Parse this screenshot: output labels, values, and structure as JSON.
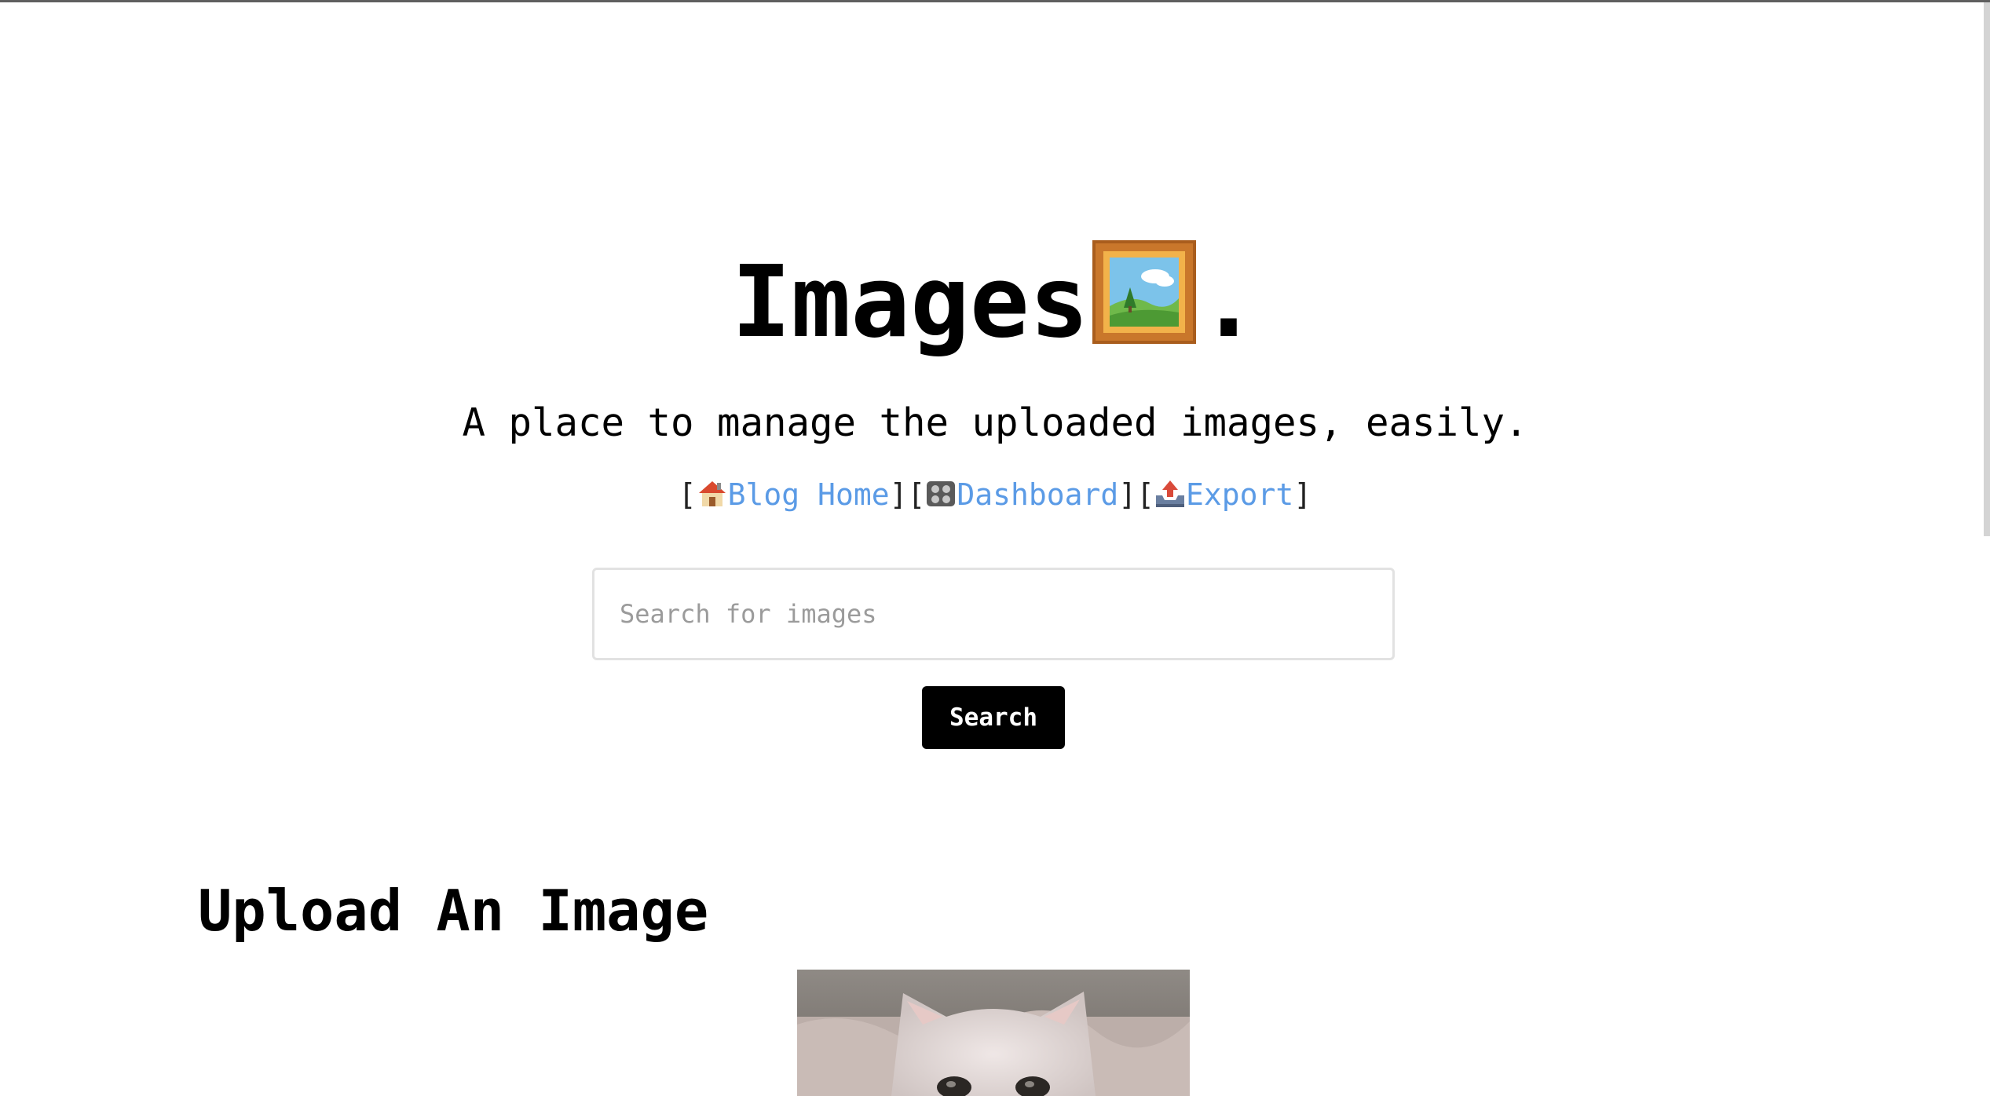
{
  "header": {
    "title": "Images",
    "title_suffix": ".",
    "title_icon": "framed-picture-icon",
    "subtitle": "A place to manage the uploaded images, easily."
  },
  "nav": {
    "bracket_open": "[",
    "bracket_close": "]",
    "links": [
      {
        "icon": "house-icon",
        "label": "Blog Home"
      },
      {
        "icon": "control-knobs-icon",
        "label": "Dashboard"
      },
      {
        "icon": "outbox-tray-icon",
        "label": "Export"
      }
    ]
  },
  "search": {
    "placeholder": "Search for images",
    "value": "",
    "button_label": "Search"
  },
  "upload": {
    "heading": "Upload An Image",
    "preview_image": "hairless-cat-photo"
  },
  "colors": {
    "link": "#5b9be6",
    "button_bg": "#000000",
    "button_text": "#ffffff",
    "input_border": "#e2e2e2",
    "placeholder": "#9b9b9b"
  }
}
